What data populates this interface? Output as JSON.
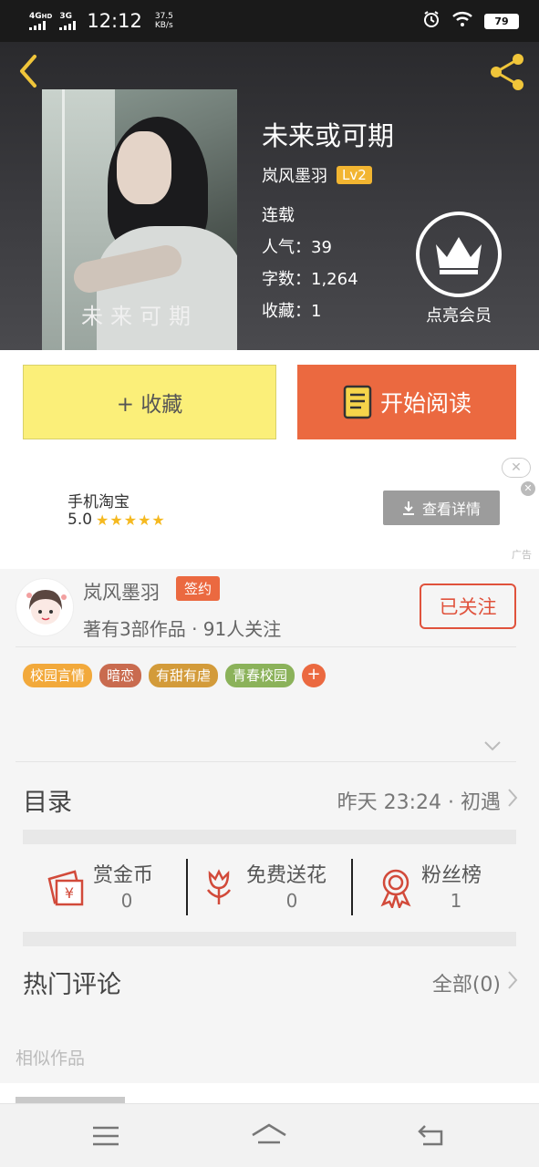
{
  "status_bar": {
    "network_left": "4G",
    "network_left_sub": "HD",
    "network_right": "3G",
    "time": "12:12",
    "speed_value": "37.5",
    "speed_unit": "KB/s",
    "battery": "79"
  },
  "header": {
    "book_title": "未来或可期",
    "cover_title": "未来可期",
    "author": "岚风墨羽",
    "level": "Lv2",
    "status": "连载",
    "popularity_label": "人气：39",
    "word_count_label": "字数：1,264",
    "favorites_label": "收藏：1",
    "vip_label": "点亮会员"
  },
  "actions": {
    "collect_label": "+ 收藏",
    "read_label": "开始阅读"
  },
  "ad": {
    "app_name": "手机淘宝",
    "rating": "5.0",
    "stars": "★★★★★",
    "button_label": "查看详情",
    "ad_tag": "广告",
    "close_outline": "✕",
    "close_dot": "✕"
  },
  "author_card": {
    "name": "岚风墨羽",
    "badge": "签约",
    "stats": "著有3部作品 · 91人关注",
    "follow_label": "已关注",
    "tags": [
      {
        "label": "校园言情",
        "color": "#f2a93b"
      },
      {
        "label": "暗恋",
        "color": "#c96b4f"
      },
      {
        "label": "有甜有虐",
        "color": "#d39b3a"
      },
      {
        "label": "青春校园",
        "color": "#8bb25a"
      }
    ],
    "add_tag": "+"
  },
  "directory": {
    "title": "目录",
    "latest": "昨天 23:24 · 初遇"
  },
  "gifts": {
    "reward": {
      "label": "赏金币",
      "value": "0"
    },
    "flowers": {
      "label": "免费送花",
      "value": "0"
    },
    "fans": {
      "label": "粉丝榜",
      "value": "1"
    }
  },
  "comments": {
    "title": "热门评论",
    "all_label": "全部(0)"
  },
  "similar": {
    "title": "相似作品"
  },
  "colors": {
    "accent": "#eb6940",
    "collect_bg": "#fbef79",
    "level_badge": "#f2b531",
    "gold_icon": "#f0c53a"
  },
  "icons": [
    "back-arrow-icon",
    "share-icon",
    "crown-icon",
    "book-icon",
    "download-icon",
    "coin-icon",
    "flower-icon",
    "medal-icon",
    "chevron-right-icon",
    "chevron-down-icon",
    "menu-icon",
    "home-icon",
    "back-icon"
  ]
}
